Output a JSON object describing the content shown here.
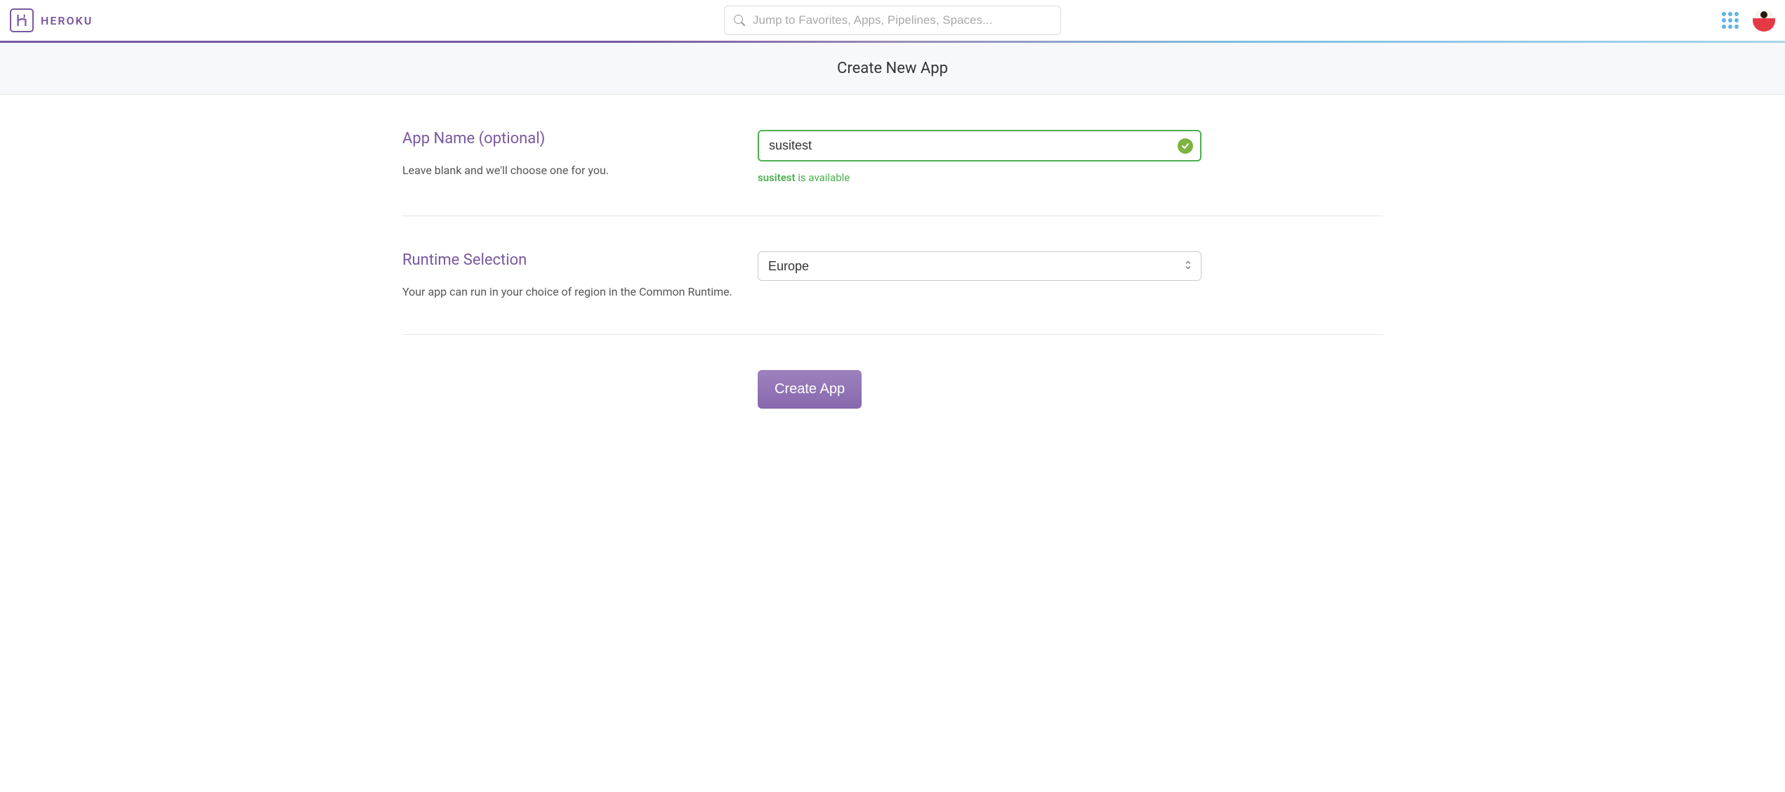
{
  "header": {
    "brand": "HEROKU",
    "search_placeholder": "Jump to Favorites, Apps, Pipelines, Spaces..."
  },
  "page": {
    "title": "Create New App"
  },
  "form": {
    "app_name": {
      "label": "App Name (optional)",
      "description": "Leave blank and we'll choose one for you.",
      "value": "susitest",
      "availability_name": "susitest",
      "availability_suffix": " is available"
    },
    "runtime": {
      "label": "Runtime Selection",
      "description": "Your app can run in your choice of region in the Common Runtime.",
      "selected": "Europe"
    },
    "submit_label": "Create App"
  }
}
